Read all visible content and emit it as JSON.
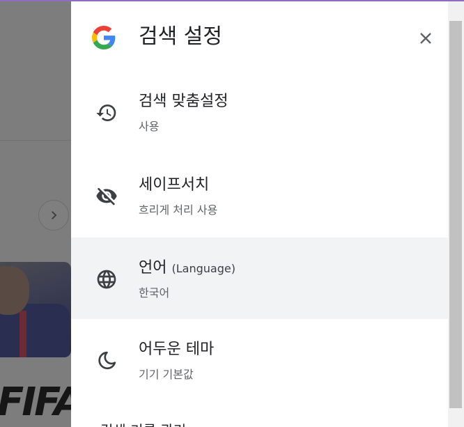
{
  "panel": {
    "title": "검색 설정",
    "items": [
      {
        "label": "검색 맞춤설정",
        "label_suffix": "",
        "desc": "사용"
      },
      {
        "label": "세이프서치",
        "label_suffix": "",
        "desc": "흐리게 처리 사용"
      },
      {
        "label": "언어",
        "label_suffix": "(Language)",
        "desc": "한국어"
      },
      {
        "label": "어두운 테마",
        "label_suffix": "",
        "desc": "기기 기본값"
      }
    ],
    "peek_text": "검색 기록 관리"
  },
  "background": {
    "logo_text": "FIFA"
  },
  "colors": {
    "panel_bg": "#ffffff",
    "active_item_bg": "#f1f3f4",
    "text_primary": "#202124",
    "text_secondary": "#5f6368",
    "scrim": "#7f7f7f",
    "top_accent": "#8e6cc2"
  },
  "icons": {
    "brand": "google-g-logo",
    "close": "close-icon",
    "items": [
      "history-icon",
      "visibility-off-icon",
      "globe-icon",
      "moon-icon"
    ]
  }
}
